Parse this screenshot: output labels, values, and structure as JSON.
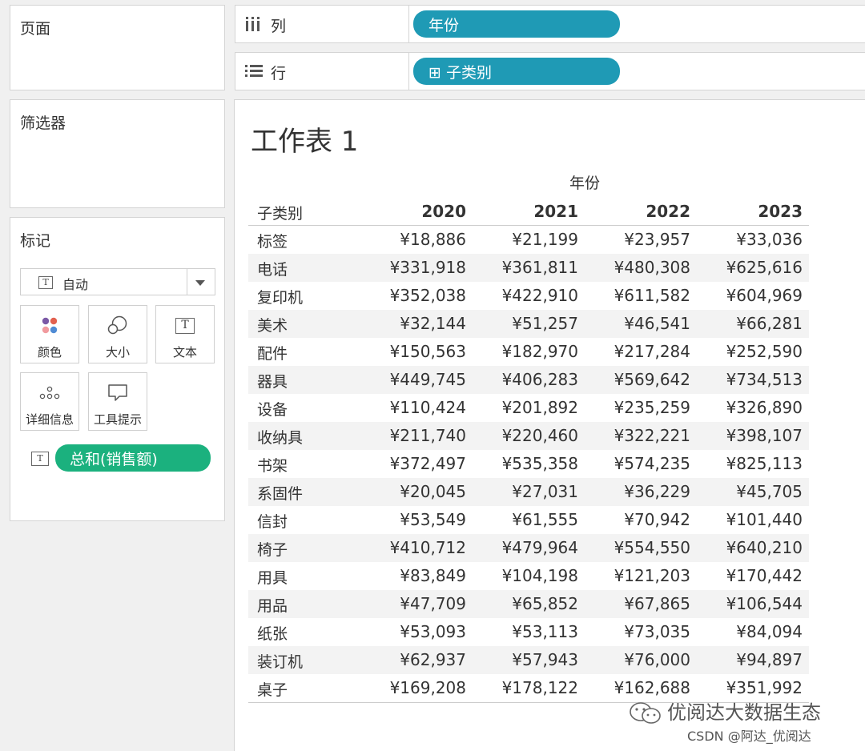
{
  "panels": {
    "pages_title": "页面",
    "filters_title": "筛选器",
    "marks_title": "标记"
  },
  "marks": {
    "type_label": "自动",
    "buttons": [
      {
        "label": "颜色",
        "icon": "color-icon"
      },
      {
        "label": "大小",
        "icon": "size-icon"
      },
      {
        "label": "文本",
        "icon": "text-icon"
      },
      {
        "label": "详细信息",
        "icon": "detail-icon"
      },
      {
        "label": "工具提示",
        "icon": "tooltip-icon"
      }
    ],
    "field_pill": "总和(销售额)"
  },
  "shelves": {
    "columns_label": "列",
    "columns_pill": "年份",
    "rows_label": "行",
    "rows_pill": "⊞ 子类别"
  },
  "sheet": {
    "title": "工作表 1",
    "year_header": "年份",
    "row_header": "子类别",
    "years": [
      "2020",
      "2021",
      "2022",
      "2023"
    ],
    "rows": [
      {
        "cat": "标签",
        "values": [
          "¥18,886",
          "¥21,199",
          "¥23,957",
          "¥33,036"
        ]
      },
      {
        "cat": "电话",
        "values": [
          "¥331,918",
          "¥361,811",
          "¥480,308",
          "¥625,616"
        ]
      },
      {
        "cat": "复印机",
        "values": [
          "¥352,038",
          "¥422,910",
          "¥611,582",
          "¥604,969"
        ]
      },
      {
        "cat": "美术",
        "values": [
          "¥32,144",
          "¥51,257",
          "¥46,541",
          "¥66,281"
        ]
      },
      {
        "cat": "配件",
        "values": [
          "¥150,563",
          "¥182,970",
          "¥217,284",
          "¥252,590"
        ]
      },
      {
        "cat": "器具",
        "values": [
          "¥449,745",
          "¥406,283",
          "¥569,642",
          "¥734,513"
        ]
      },
      {
        "cat": "设备",
        "values": [
          "¥110,424",
          "¥201,892",
          "¥235,259",
          "¥326,890"
        ]
      },
      {
        "cat": "收纳具",
        "values": [
          "¥211,740",
          "¥220,460",
          "¥322,221",
          "¥398,107"
        ]
      },
      {
        "cat": "书架",
        "values": [
          "¥372,497",
          "¥535,358",
          "¥574,235",
          "¥825,113"
        ]
      },
      {
        "cat": "系固件",
        "values": [
          "¥20,045",
          "¥27,031",
          "¥36,229",
          "¥45,705"
        ]
      },
      {
        "cat": "信封",
        "values": [
          "¥53,549",
          "¥61,555",
          "¥70,942",
          "¥101,440"
        ]
      },
      {
        "cat": "椅子",
        "values": [
          "¥410,712",
          "¥479,964",
          "¥554,550",
          "¥640,210"
        ]
      },
      {
        "cat": "用具",
        "values": [
          "¥83,849",
          "¥104,198",
          "¥121,203",
          "¥170,442"
        ]
      },
      {
        "cat": "用品",
        "values": [
          "¥47,709",
          "¥65,852",
          "¥67,865",
          "¥106,544"
        ]
      },
      {
        "cat": "纸张",
        "values": [
          "¥53,093",
          "¥53,113",
          "¥73,035",
          "¥84,094"
        ]
      },
      {
        "cat": "装订机",
        "values": [
          "¥62,937",
          "¥57,943",
          "¥76,000",
          "¥94,897"
        ]
      },
      {
        "cat": "桌子",
        "values": [
          "¥169,208",
          "¥178,122",
          "¥162,688",
          "¥351,992"
        ]
      }
    ]
  },
  "watermark": {
    "text": "优阅达大数据生态",
    "csdn": "CSDN @阿达_优阅达"
  },
  "colors": {
    "pill_blue": "#1f9ab5",
    "pill_green": "#1bb17e"
  }
}
